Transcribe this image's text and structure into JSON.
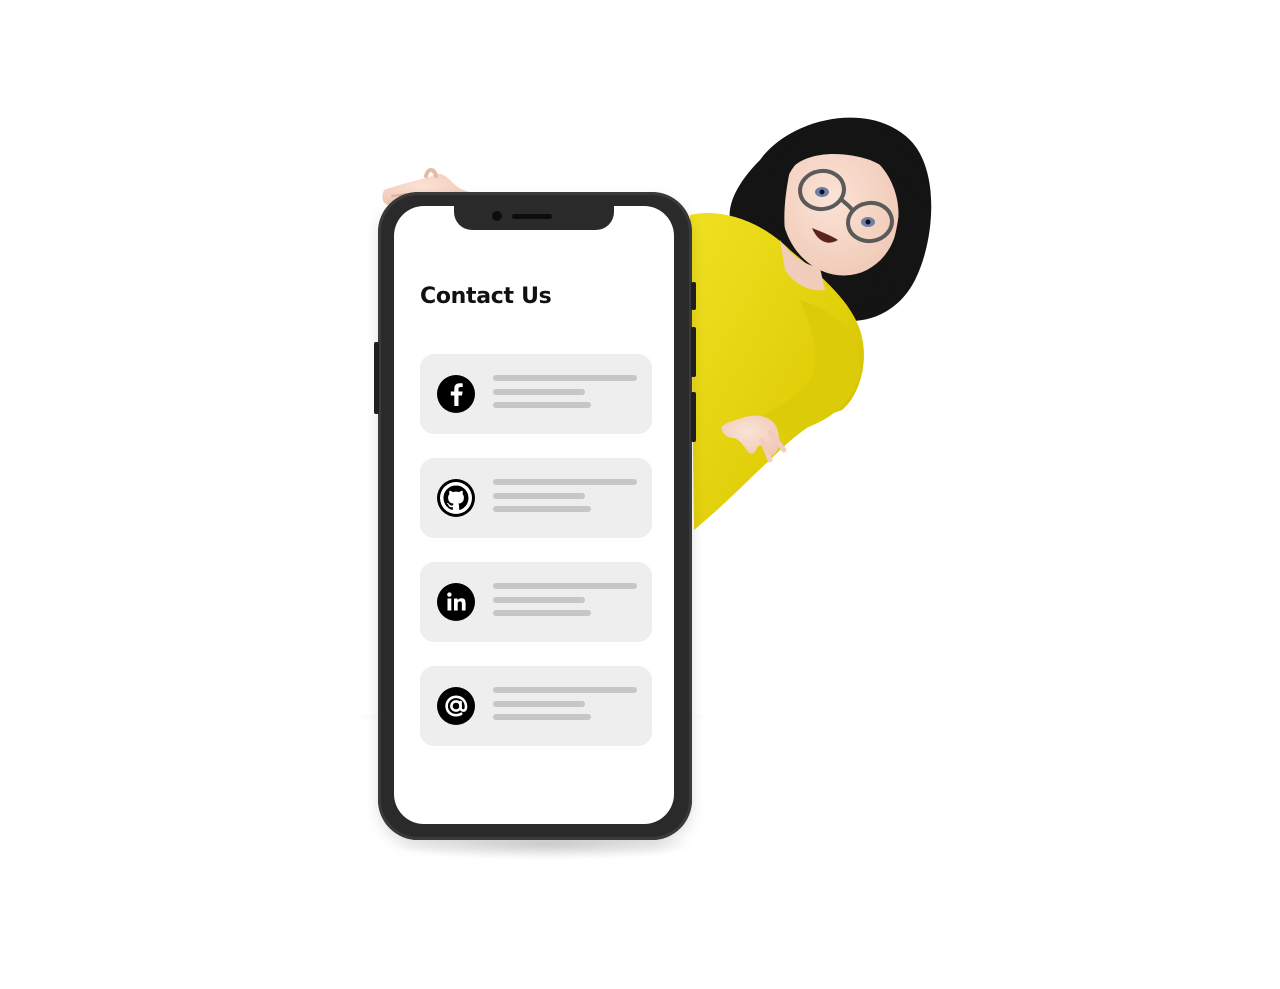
{
  "screen": {
    "title": "Contact Us"
  },
  "contacts": [
    {
      "icon": "facebook-icon"
    },
    {
      "icon": "github-icon"
    },
    {
      "icon": "linkedin-icon"
    },
    {
      "icon": "email-at-icon"
    }
  ],
  "colors": {
    "background": "#ffffff",
    "phone_frame": "#2a2a2a",
    "card_background": "#eeeeee",
    "placeholder_line": "#c6c6c6",
    "sweater": "#e3d20e",
    "hair": "#141414"
  }
}
